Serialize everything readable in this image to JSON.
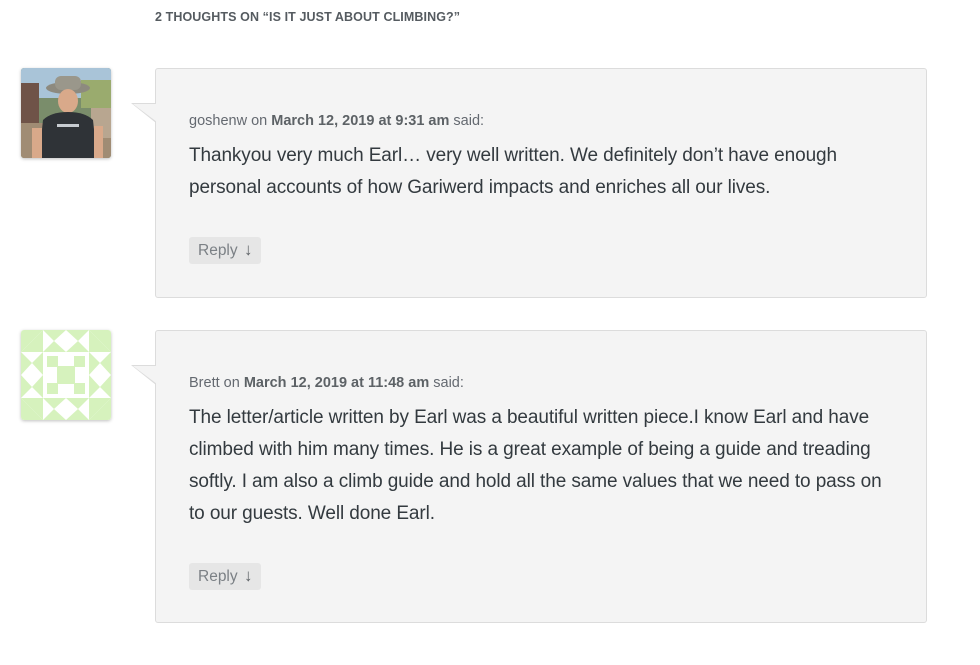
{
  "comments_section": {
    "title": "2 THOUGHTS ON “IS IT JUST ABOUT CLIMBING?”"
  },
  "comments": [
    {
      "author": "goshenw",
      "on_word": "on",
      "date": "March 12, 2019 at 9:31 am",
      "said_word": "said:",
      "text": "Thankyou very much Earl… very well written. We definitely don’t have enough personal accounts of how Gariwerd impacts and enriches all our lives.",
      "reply_label": "Reply",
      "reply_arrow": "↓",
      "avatar": "photo-avatar"
    },
    {
      "author": "Brett",
      "on_word": "on",
      "date": "March 12, 2019 at 11:48 am",
      "said_word": "said:",
      "text": "The letter/article written by Earl was a beautiful written piece.I know Earl and have climbed with him many times. He is a great example of being a guide and treading softly. I am also a climb guide and hold all the same values that we need to pass on to our guests. Well done Earl.",
      "reply_label": "Reply",
      "reply_arrow": "↓",
      "avatar": "identicon-avatar",
      "avatar_color": "#d6f2bd"
    }
  ],
  "colors": {
    "comment_bg": "#f4f4f4",
    "comment_border": "#dcdcdc",
    "text": "#333a3f",
    "meta": "#646970",
    "reply_bg": "#e6e6e6"
  }
}
